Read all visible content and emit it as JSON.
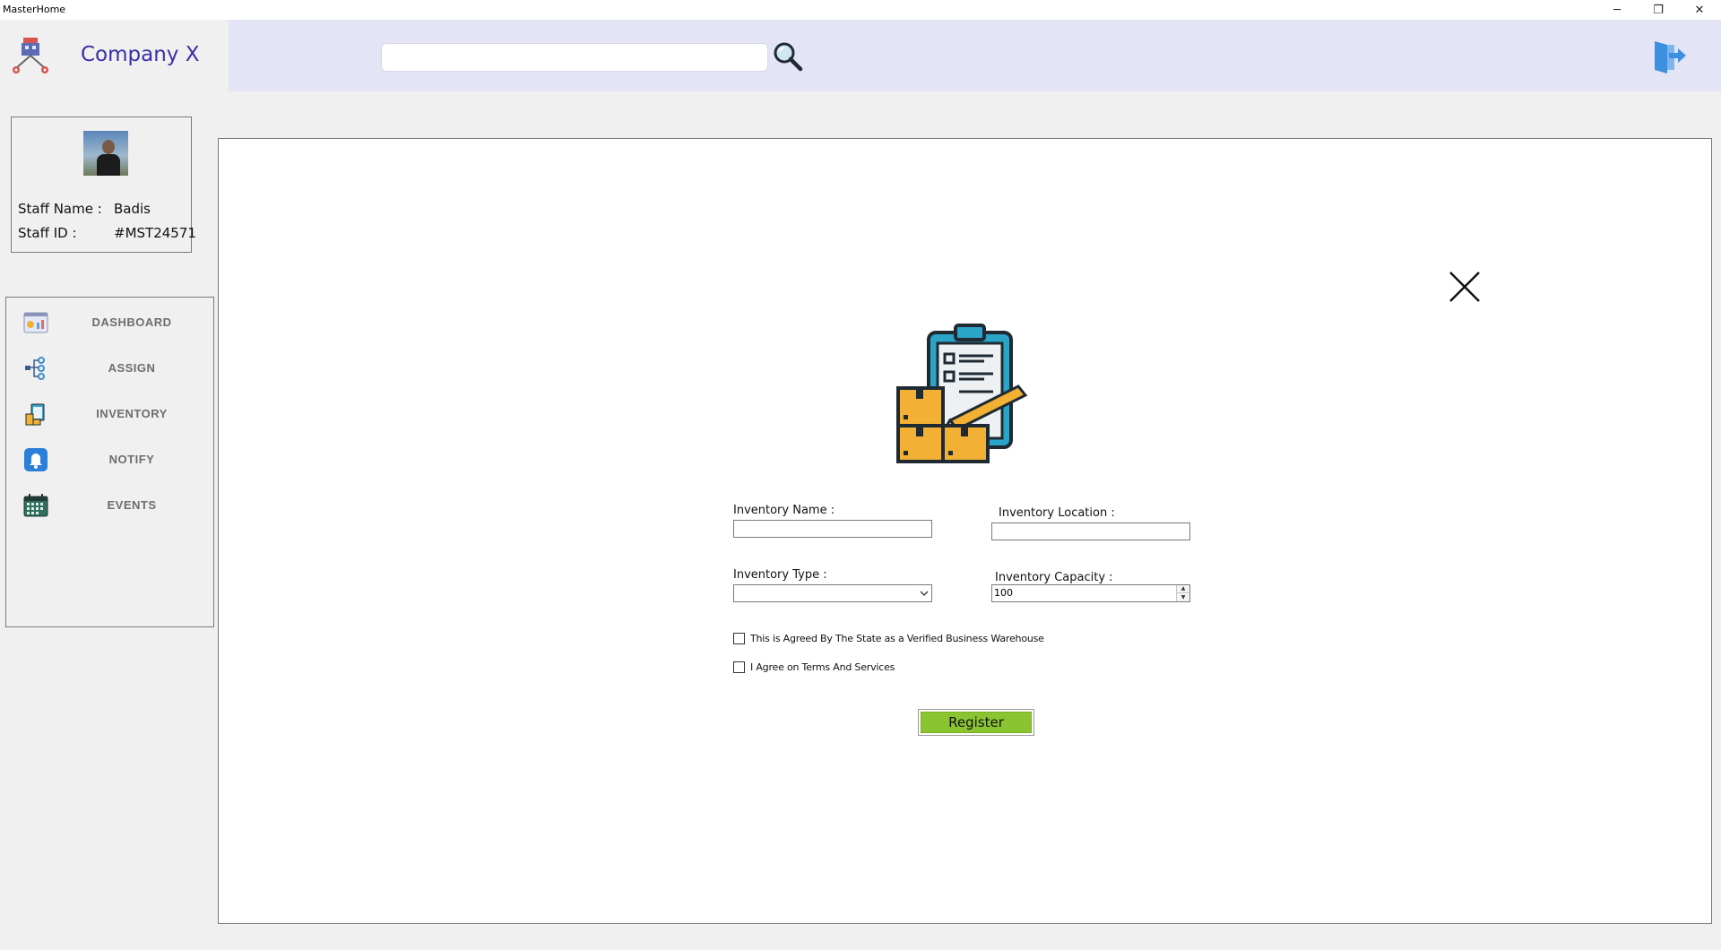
{
  "window": {
    "title": "MasterHome",
    "minimize": "─",
    "restore": "❐",
    "close": "✕"
  },
  "header": {
    "company_name": "Company X",
    "search": {
      "value": "",
      "placeholder": ""
    },
    "icons": {
      "logo": "delivery-network-icon",
      "search": "magnifier-icon",
      "logout": "logout-door-icon"
    }
  },
  "staff": {
    "name_label": "Staff  Name :",
    "name_value": "Badis",
    "id_label": "Staff ID :",
    "id_value": "#MST24571"
  },
  "nav": {
    "items": [
      {
        "label": "DASHBOARD",
        "icon": "dashboard-icon"
      },
      {
        "label": "ASSIGN",
        "icon": "assign-icon"
      },
      {
        "label": "INVENTORY",
        "icon": "inventory-icon"
      },
      {
        "label": "NOTIFY",
        "icon": "bell-icon"
      },
      {
        "label": "EVENTS",
        "icon": "calendar-icon"
      }
    ]
  },
  "form": {
    "hero_icon": "inventory-clipboard-boxes-icon",
    "inventory_name_label": "Inventory Name :",
    "inventory_name_value": "",
    "inventory_location_label": "Inventory Location :",
    "inventory_location_value": "",
    "inventory_type_label": "Inventory Type :",
    "inventory_type_value": "",
    "inventory_capacity_label": "Inventory Capacity :",
    "inventory_capacity_value": "100",
    "checkbox_verified_label": "This is Agreed By The State as a Verified Business Warehouse",
    "checkbox_verified_checked": false,
    "checkbox_terms_label": "I Agree on Terms And Services",
    "checkbox_terms_checked": false,
    "register_label": "Register"
  },
  "colors": {
    "accent": "#3b2fa6",
    "topbar": "#e4e4f7",
    "register_button": "#8ac531"
  }
}
